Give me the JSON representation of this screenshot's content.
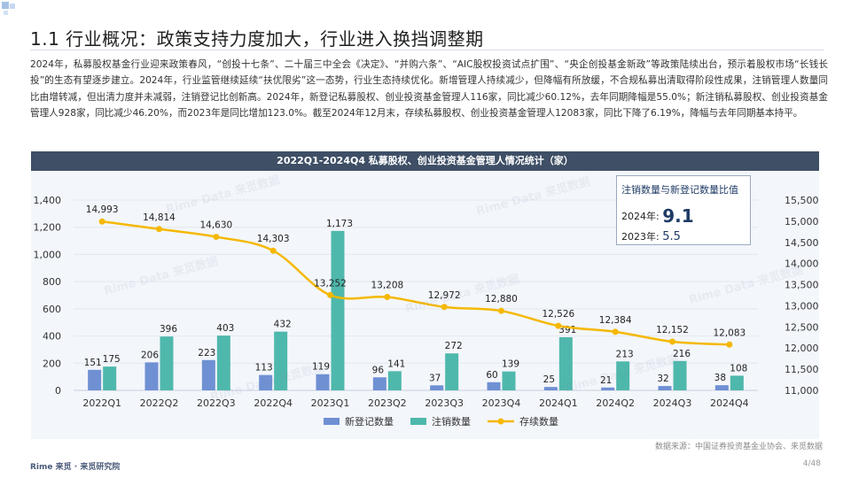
{
  "page": {
    "title": "1.1 行业概况：政策支持力度加大，行业进入换挡调整期",
    "intro": "2024年，私募股权基金行业迎来政策春风，“创投十七条”、二十届三中全会《决定》、“并购六条”、“AIC股权投资试点扩围”、“央企创投基金新政”等政策陆续出台，预示着股权市场“长钱长投”的生态有望逐步建立。2024年，行业监管继续延续“扶优限劣”这一态势，行业生态持续优化。新增管理人持续减少，但降幅有所放缓，不合规私募出清取得阶段性成果，注销管理人数量同比由增转减，但出清力度并未减弱，注销登记比创新高。2024年，新登记私募股权、创业投资基金管理人116家，同比减少60.12%，去年同期降幅是55.0%；新注销私募股权、创业投资基金管理人928家，同比减少46.20%，而2023年是同比增加123.0%。截至2024年12月末，存续私募股权、创业投资基金管理人12083家，同比下降了6.19%，降幅与去年同期基本持平。",
    "source": "数据来源：中国证券投资基金业协会、来觅数据",
    "brand": "Rime 来觅 · 来觅研究院",
    "page_number": "4/48",
    "watermark": "Rime Data 来觅数据"
  },
  "ratio_box": {
    "title": "注销数量与新登记数量比值",
    "row1_label": "2024年:",
    "row1_value": "9.1",
    "row2_label": "2023年:",
    "row2_value": "5.5"
  },
  "colors": {
    "new_registered": "#6f90d3",
    "deregistered": "#4fb8ac",
    "existing": "#f5b800",
    "header_bg": "#3e4f66"
  },
  "chart_data": {
    "type": "bar",
    "title": "2022Q1-2024Q4 私募股权、创业投资基金管理人情况统计（家）",
    "categories": [
      "2022Q1",
      "2022Q2",
      "2022Q3",
      "2022Q4",
      "2023Q1",
      "2023Q2",
      "2023Q3",
      "2023Q4",
      "2024Q1",
      "2024Q2",
      "2024Q3",
      "2024Q4"
    ],
    "series": [
      {
        "name": "新登记数量",
        "type": "bar",
        "axis": "left",
        "values": [
          151,
          206,
          223,
          113,
          119,
          96,
          37,
          60,
          25,
          21,
          32,
          38
        ]
      },
      {
        "name": "注销数量",
        "type": "bar",
        "axis": "left",
        "values": [
          175,
          396,
          403,
          432,
          1173,
          141,
          272,
          139,
          391,
          213,
          216,
          108
        ]
      },
      {
        "name": "存续数量",
        "type": "line",
        "axis": "right",
        "values": [
          14993,
          14814,
          14630,
          14303,
          13252,
          13208,
          12972,
          12880,
          12526,
          12384,
          12152,
          12083
        ]
      }
    ],
    "left_axis": {
      "min": 0,
      "max": 1400,
      "ticks": [
        "0",
        "200",
        "400",
        "600",
        "800",
        "1,000",
        "1,200",
        "1,400"
      ]
    },
    "right_axis": {
      "min": 11000,
      "max": 15500,
      "ticks": [
        "11,000",
        "11,500",
        "12,000",
        "12,500",
        "13,000",
        "13,500",
        "14,000",
        "14,500",
        "15,000",
        "15,500"
      ]
    },
    "bar_labels": [
      [
        "151",
        "206",
        "223",
        "113",
        "119",
        "96",
        "37",
        "60",
        "25",
        "21",
        "32",
        "38"
      ],
      [
        "175",
        "396",
        "403",
        "432",
        "1,173",
        "141",
        "272",
        "139",
        "391",
        "213",
        "216",
        "108"
      ]
    ],
    "line_labels": [
      "14,993",
      "14,814",
      "14,630",
      "14,303",
      "13,252",
      "13,208",
      "12,972",
      "12,880",
      "12,526",
      "12,384",
      "12,152",
      "12,083"
    ],
    "legend": [
      "新登记数量",
      "注销数量",
      "存续数量"
    ],
    "legend_position": "bottom",
    "grid": true
  }
}
